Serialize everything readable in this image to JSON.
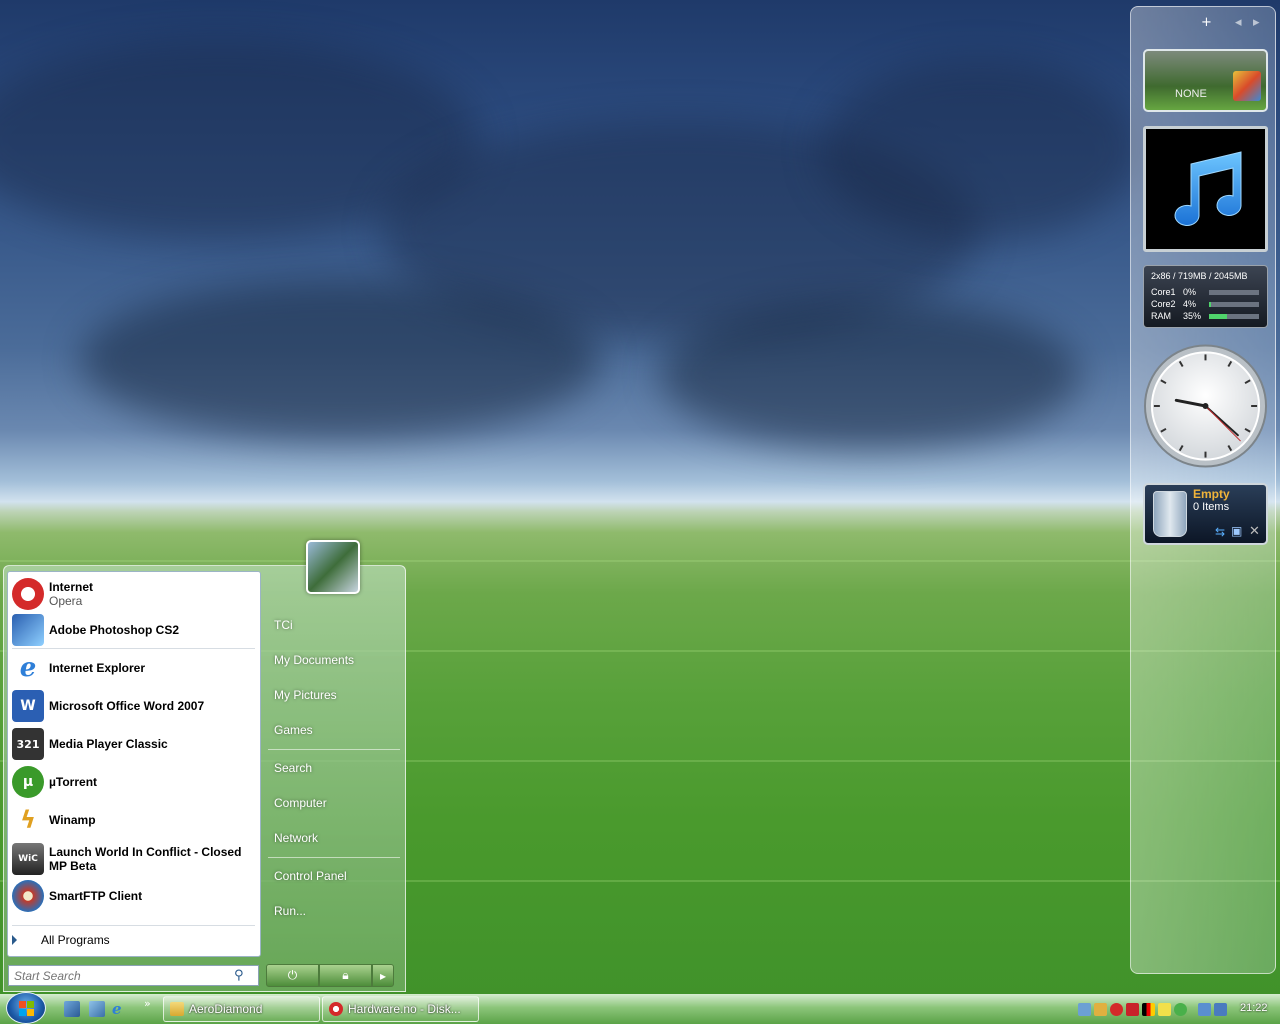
{
  "sidebar": {
    "add_icon_label": "+",
    "prev_icon_label": "◂",
    "next_icon_label": "▸",
    "slideshow_label": "NONE",
    "cpu_header": "2x86 / 719MB / 2045MB",
    "meters": [
      {
        "name": "Core1",
        "percent": "0%",
        "level": 0
      },
      {
        "name": "Core2",
        "percent": "4%",
        "level": 0.04
      },
      {
        "name": "RAM",
        "percent": "35%",
        "level": 0.35
      }
    ],
    "clock_time": "21:22",
    "recycle_status": "Empty",
    "recycle_count": "0 Items"
  },
  "start_menu": {
    "pinned": [
      {
        "name": "Internet",
        "sub": "Opera",
        "icon": "opera-icon",
        "color": "#d42a2a"
      },
      {
        "name": "Adobe Photoshop CS2",
        "icon": "photoshop-feather-icon",
        "color": "#4a7fc7"
      }
    ],
    "recent": [
      {
        "name": "Internet Explorer",
        "icon": "internet-explorer-icon",
        "color": "#2e7fd8"
      },
      {
        "name": "Microsoft Office Word 2007",
        "icon": "word-icon",
        "color": "#2b5fb3"
      },
      {
        "name": "Media Player Classic",
        "icon": "media-player-classic-icon",
        "color": "#555555"
      },
      {
        "name": "µTorrent",
        "icon": "utorrent-icon",
        "color": "#3a9a2a"
      },
      {
        "name": "Winamp",
        "icon": "winamp-icon",
        "color": "#e0a020"
      },
      {
        "name": "Launch World In Conflict - Closed MP Beta",
        "icon": "world-in-conflict-icon",
        "color": "#444444"
      },
      {
        "name": "SmartFTP Client",
        "icon": "smartftp-icon",
        "color": "#c23b2a"
      }
    ],
    "all_programs": "All Programs",
    "right_links": [
      "TCi",
      "My Documents",
      "My Pictures",
      "Games",
      "Search",
      "Computer",
      "Network",
      "Control Panel",
      "Run..."
    ],
    "search_placeholder": "Start Search"
  },
  "taskbar": {
    "quick_launch_more": "»",
    "tasks": [
      {
        "label": "AeroDiamond",
        "icon": "folder-icon"
      },
      {
        "label": "Hardware.no - Disk...",
        "icon": "opera-icon"
      }
    ],
    "clock": "21:22"
  }
}
